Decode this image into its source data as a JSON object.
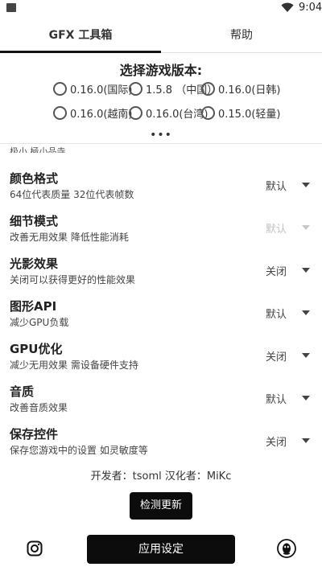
{
  "status_bar": {
    "time": "9:04"
  },
  "tabs": [
    {
      "label": "GFX 工具箱",
      "active": true
    },
    {
      "label": "帮助",
      "active": false
    }
  ],
  "version_selector": {
    "title": "选择游戏版本:",
    "options_row1": [
      "0.16.0(国际)",
      "1.5.8 （中国）",
      "0.16.0(日韩)"
    ],
    "options_row2": [
      "0.16.0(越南)",
      "0.16.0(台湾)",
      "0.15.0(轻量)"
    ],
    "more": "•••"
  },
  "cutoff_text": "极小 極小品寺",
  "settings": [
    {
      "title": "颜色格式",
      "desc": "64位代表质量 32位代表帧数",
      "value": "默认",
      "disabled": false
    },
    {
      "title": "细节模式",
      "desc": "改善无用效果 降低性能消耗",
      "value": "默认",
      "disabled": true
    },
    {
      "title": "光影效果",
      "desc": "关闭可以获得更好的性能效果",
      "value": "关闭",
      "disabled": false
    },
    {
      "title": "图形API",
      "desc": "减少GPU负载",
      "value": "默认",
      "disabled": false
    },
    {
      "title": "GPU优化",
      "desc": "减少无用效果 需设备硬件支持",
      "value": "关闭",
      "disabled": false
    },
    {
      "title": "音质",
      "desc": "改善音质效果",
      "value": "默认",
      "disabled": false
    },
    {
      "title": "保存控件",
      "desc": "保存您游戏中的设置 如灵敏度等",
      "value": "关闭",
      "disabled": false
    }
  ],
  "credits": "开发者：tsoml   汉化者：MiKc",
  "buttons": {
    "check_update": "检测更新",
    "apply": "应用设定"
  },
  "icons": {
    "left": "instagram-icon",
    "right": "qq-icon"
  },
  "colors": {
    "primary": "#0c0c0c",
    "disabled": "#c2c2c2"
  }
}
